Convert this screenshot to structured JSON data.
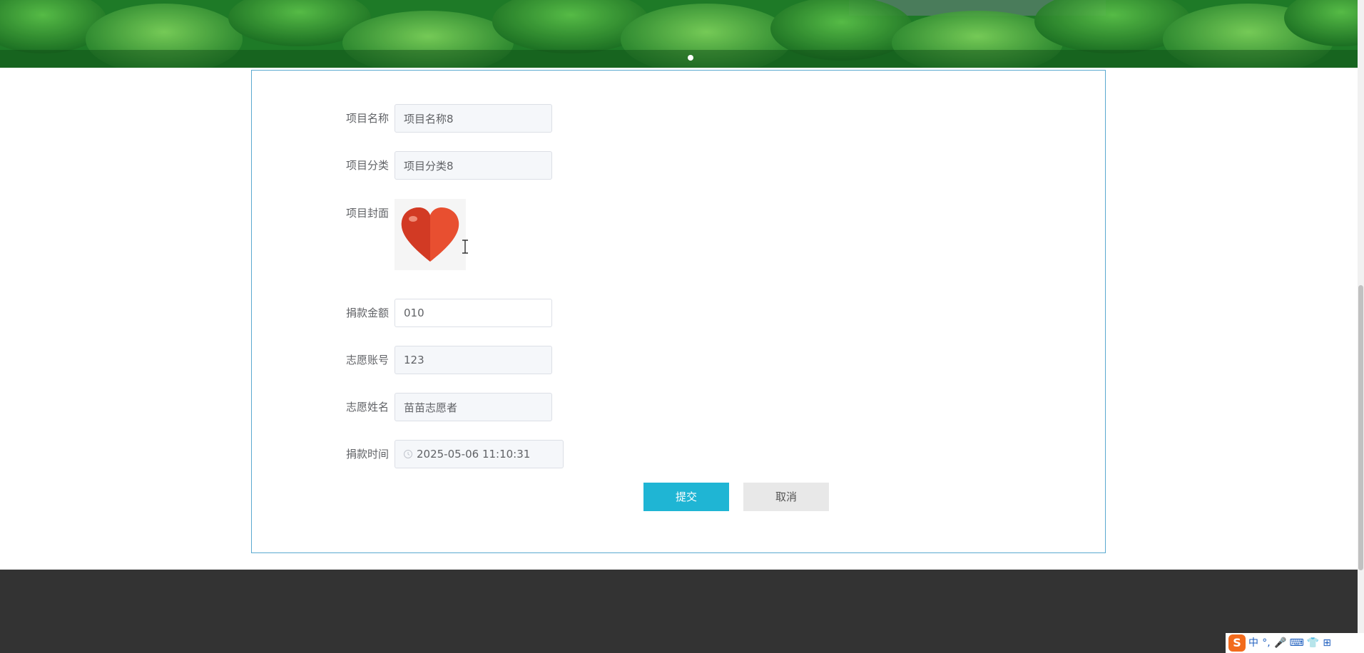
{
  "form": {
    "fields": {
      "project_name": {
        "label": "项目名称",
        "value": "项目名称8"
      },
      "project_category": {
        "label": "项目分类",
        "value": "项目分类8"
      },
      "project_cover": {
        "label": "项目封面"
      },
      "donation_amount": {
        "label": "捐款金额",
        "value": "010"
      },
      "volunteer_account": {
        "label": "志愿账号",
        "value": "123"
      },
      "volunteer_name": {
        "label": "志愿姓名",
        "value": "苗苗志愿者"
      },
      "donation_time": {
        "label": "捐款时间",
        "value": "2025-05-06 11:10:31"
      }
    },
    "buttons": {
      "submit_label": "提交",
      "cancel_label": "取消"
    }
  },
  "ime": {
    "logo": "S",
    "items": [
      "中",
      "°,",
      "🎤",
      "⌨",
      "👕",
      "⊞"
    ]
  },
  "colors": {
    "accent": "#1fb5d4",
    "border": "#5aa9d0",
    "footer": "#333333",
    "heart": "#e0462e"
  }
}
